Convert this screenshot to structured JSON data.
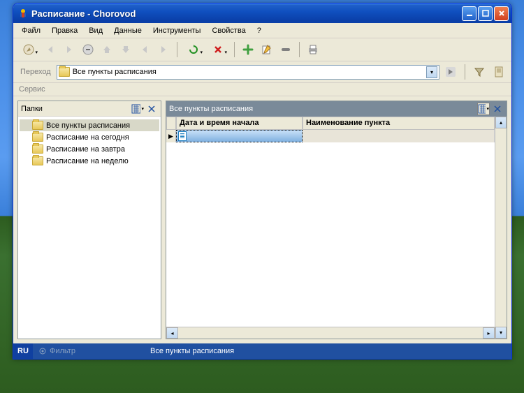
{
  "title": "Расписание - Chorovod",
  "menu": [
    "Файл",
    "Правка",
    "Вид",
    "Данные",
    "Инструменты",
    "Свойства",
    "?"
  ],
  "address": {
    "label": "Переход",
    "value": "Все пункты расписания"
  },
  "service_label": "Сервис",
  "left_panel": {
    "title": "Папки",
    "items": [
      "Все пункты расписания",
      "Расписание на сегодня",
      "Расписание на завтра",
      "Расписание на неделю"
    ]
  },
  "right_panel": {
    "title": "Все пункты расписания",
    "columns": [
      "Дата и время начала",
      "Наименование пункта"
    ]
  },
  "statusbar": {
    "lang": "RU",
    "filter": "Фильтр",
    "text": "Все пункты расписания"
  }
}
